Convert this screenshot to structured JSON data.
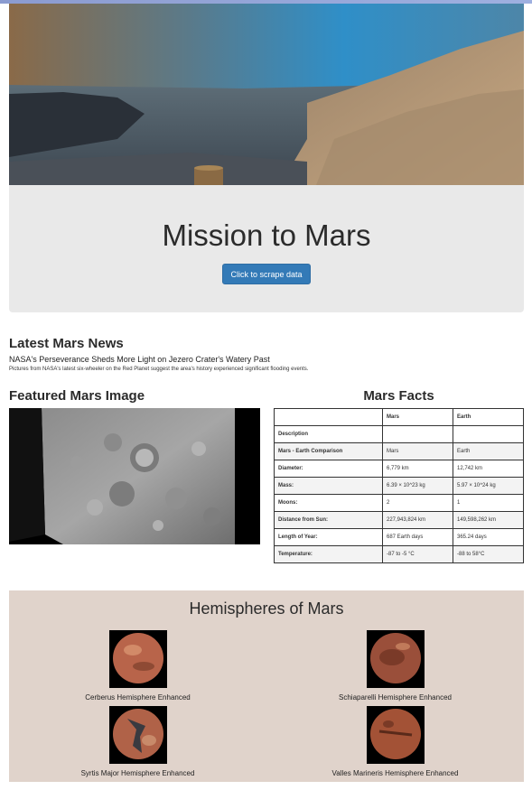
{
  "hero": {
    "image_label": "Mars landscape panorama"
  },
  "jumbotron": {
    "title": "Mission to Mars",
    "scrape_button": "Click to scrape data"
  },
  "news": {
    "heading": "Latest Mars News",
    "title": "NASA's Perseverance Sheds More Light on Jezero Crater's Watery Past",
    "paragraph": "Pictures from NASA's latest six-wheeler on the Red Planet suggest the area's history experienced significant flooding events."
  },
  "featured": {
    "heading": "Featured Mars Image"
  },
  "facts": {
    "heading": "Mars Facts",
    "columns": [
      "",
      "Mars",
      "Earth"
    ],
    "rows": [
      [
        "Description",
        "",
        ""
      ],
      [
        "Mars - Earth Comparison",
        "Mars",
        "Earth"
      ],
      [
        "Diameter:",
        "6,779 km",
        "12,742 km"
      ],
      [
        "Mass:",
        "6.39 × 10^23 kg",
        "5.97 × 10^24 kg"
      ],
      [
        "Moons:",
        "2",
        "1"
      ],
      [
        "Distance from Sun:",
        "227,943,824 km",
        "149,598,262 km"
      ],
      [
        "Length of Year:",
        "687 Earth days",
        "365.24 days"
      ],
      [
        "Temperature:",
        "-87 to -5 °C",
        "-88 to 58°C"
      ]
    ]
  },
  "hemispheres": {
    "heading": "Hemispheres of Mars",
    "items": [
      {
        "title": "Cerberus Hemisphere Enhanced",
        "color": "#b8644a"
      },
      {
        "title": "Schiaparelli Hemisphere Enhanced",
        "color": "#9a4f3a"
      },
      {
        "title": "Syrtis Major Hemisphere Enhanced",
        "color": "#b06248"
      },
      {
        "title": "Valles Marineris Hemisphere Enhanced",
        "color": "#a35236"
      }
    ]
  }
}
